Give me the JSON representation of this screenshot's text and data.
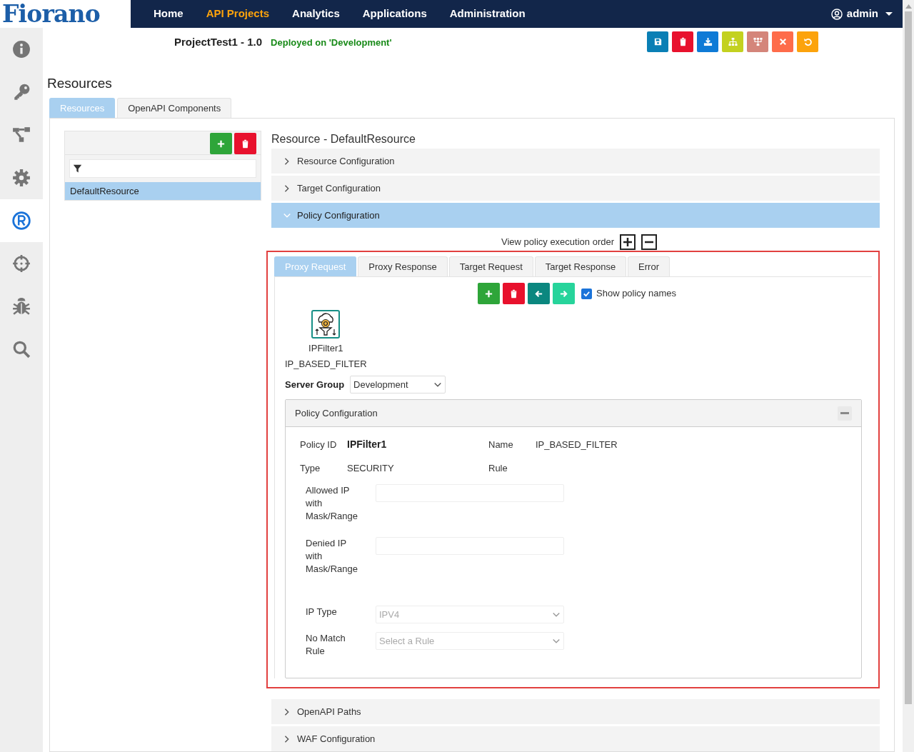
{
  "nav": {
    "logo": "Fiorano",
    "items": [
      {
        "label": "Home",
        "selected": false
      },
      {
        "label": "API Projects",
        "selected": true
      },
      {
        "label": "Analytics",
        "selected": false
      },
      {
        "label": "Applications",
        "selected": false
      },
      {
        "label": "Administration",
        "selected": false
      }
    ],
    "user": "admin"
  },
  "sidebar": {
    "items": [
      {
        "kind": "info",
        "selected": false
      },
      {
        "kind": "key",
        "selected": false
      },
      {
        "kind": "flow",
        "selected": false
      },
      {
        "kind": "gear",
        "selected": false
      },
      {
        "kind": "registered",
        "selected": true
      },
      {
        "kind": "target",
        "selected": false
      },
      {
        "kind": "bug",
        "selected": false
      },
      {
        "kind": "search",
        "selected": false
      }
    ]
  },
  "project": {
    "title": "ProjectTest1 - 1.0",
    "status": "Deployed on 'Development'"
  },
  "toolbar": [
    {
      "kind": "save"
    },
    {
      "kind": "delete"
    },
    {
      "kind": "download"
    },
    {
      "kind": "hierarchy"
    },
    {
      "kind": "network"
    },
    {
      "kind": "close"
    },
    {
      "kind": "undo"
    }
  ],
  "page_title": "Resources",
  "tabs": [
    {
      "label": "Resources",
      "selected": true
    },
    {
      "label": "OpenAPI Components",
      "selected": false
    }
  ],
  "resource_list": {
    "items": [
      {
        "label": "DefaultResource",
        "selected": true
      }
    ]
  },
  "resource_heading": "Resource - DefaultResource",
  "sections": [
    {
      "label": "Resource Configuration",
      "expanded": false
    },
    {
      "label": "Target Configuration",
      "expanded": false
    },
    {
      "label": "Policy Configuration",
      "expanded": true
    },
    {
      "label": "OpenAPI Paths",
      "expanded": false
    },
    {
      "label": "WAF Configuration",
      "expanded": false
    }
  ],
  "policy": {
    "execution_order_label": "View policy execution order",
    "flow_tabs": [
      {
        "label": "Proxy Request",
        "selected": true
      },
      {
        "label": "Proxy Response",
        "selected": false
      },
      {
        "label": "Target Request",
        "selected": false
      },
      {
        "label": "Target Response",
        "selected": false
      },
      {
        "label": "Error",
        "selected": false
      }
    ],
    "show_names": {
      "label": "Show policy names",
      "checked": true
    },
    "policies": [
      {
        "id": "IPFilter1",
        "name": "IP_BASED_FILTER"
      }
    ],
    "server_group": {
      "label": "Server Group",
      "value": "Development"
    },
    "config": {
      "title": "Policy Configuration",
      "info": [
        {
          "label": "Policy ID",
          "value": "IPFilter1",
          "bold": true
        },
        {
          "label": "Name",
          "value": "IP_BASED_FILTER",
          "bold": false
        },
        {
          "label": "Type",
          "value": "SECURITY",
          "bold": false
        },
        {
          "label": "Rule"
        }
      ],
      "fields": [
        {
          "kind": "text",
          "label": "Allowed IP with Mask/Range"
        },
        {
          "kind": "text",
          "label": "Denied IP with Mask/Range"
        },
        {
          "kind": "select",
          "label": "IP Type",
          "value": "IPV4",
          "disabled": true
        },
        {
          "kind": "select",
          "label": "No Match Rule",
          "placeholder": "Select a Rule",
          "disabled": true
        }
      ]
    }
  }
}
